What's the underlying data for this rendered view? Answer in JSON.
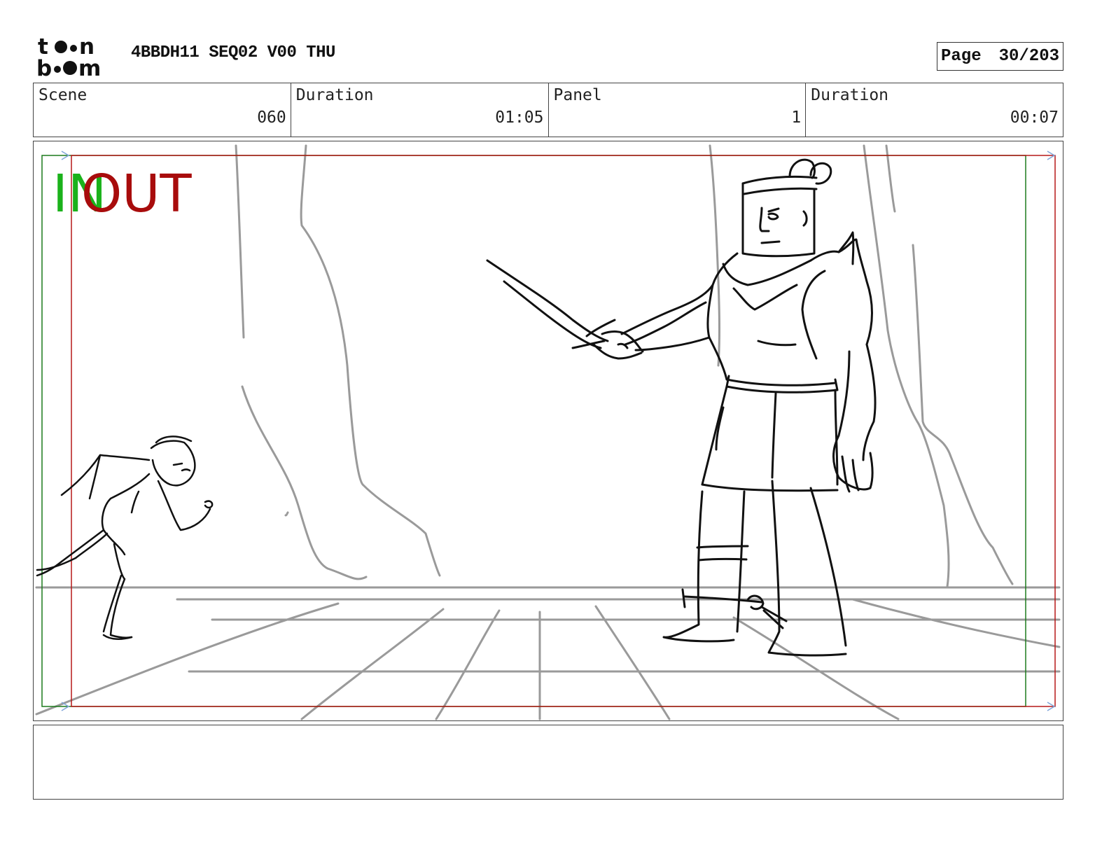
{
  "header": {
    "logo_icon": "toon-boom-logo-icon",
    "title": "4BBDH11 SEQ02 V00 THU",
    "page_label": "Page",
    "page_value": "30/203"
  },
  "info": {
    "scene_label": "Scene",
    "scene_value": "060",
    "scene_duration_label": "Duration",
    "scene_duration_value": "01:05",
    "panel_label": "Panel",
    "panel_value": "1",
    "panel_duration_label": "Duration",
    "panel_duration_value": "00:07"
  },
  "frame": {
    "in_label": "IN",
    "out_label": "OUT",
    "in_color": "#1bb21b",
    "out_color": "#a80c0c"
  },
  "caption": {
    "text": ""
  }
}
